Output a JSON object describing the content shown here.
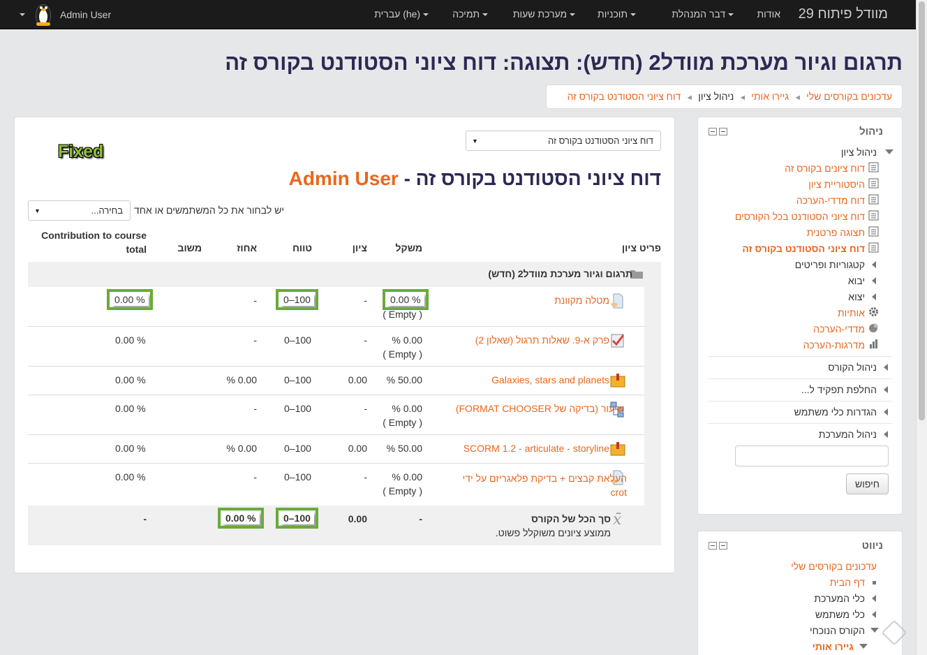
{
  "navbar": {
    "brand": "מוודל פיתוח 29",
    "items": [
      "אודות",
      "דבר המנהלת",
      "תוכניות",
      "מערכת שעות",
      "תמיכה",
      "עברית (he)"
    ],
    "user_name": "Admin User"
  },
  "page": {
    "heading": "תרגום וגיור מערכת מוודל2 (חדש): תצוגה: דוח ציוני הסטודנט בקורס זה",
    "breadcrumb": [
      "עדכונים בקורסים שלי",
      "גיירו אותי",
      "ניהול ציון",
      "דוח ציוני הסטודנט בקורס זה"
    ]
  },
  "main": {
    "report_select": "דוח ציוני הסטודנט בקורס זה",
    "fixed_logo": "Fixed",
    "report_title": "דוח ציוני הסטודנט בקורס זה - ",
    "report_user": "Admin User",
    "user_select_label": "יש לבחור את כל המשתמשים או אחד",
    "user_select_value": "בחירה...",
    "columns": {
      "item": "פריט ציון",
      "weight": "משקל",
      "grade": "ציון",
      "range": "טווח",
      "percent": "אחוז",
      "feedback": "משוב",
      "contribution_1": "Contribution to course",
      "contribution_2": "total"
    },
    "category": "תרגום וגיור מערכת מוודל2 (חדש)",
    "rows": [
      {
        "name": "מטלה מקוונת",
        "weight": "0.00 %",
        "weight_note": "( Empty )",
        "grade": "-",
        "range": "0–100",
        "percent": "-",
        "contribution": "0.00 %"
      },
      {
        "name": "פרק א-9. שאלות תרגול (שאלון 2)",
        "weight": "0.00 %",
        "weight_note": "( Empty )",
        "grade": "-",
        "range": "0–100",
        "percent": "-",
        "contribution": "0.00 %"
      },
      {
        "name": "Galaxies, stars and planets",
        "weight": "50.00 %",
        "weight_note": "",
        "grade": "0.00",
        "range": "0–100",
        "percent": "0.00 %",
        "contribution": "0.00 %"
      },
      {
        "name": "שיעור (בדיקה של FORMAT CHOOSER)",
        "weight": "0.00 %",
        "weight_note": "( Empty )",
        "grade": "-",
        "range": "0–100",
        "percent": "-",
        "contribution": "0.00 %"
      },
      {
        "name": "SCORM 1.2 - articulate - storyline",
        "weight": "50.00 %",
        "weight_note": "",
        "grade": "0.00",
        "range": "0–100",
        "percent": "0.00 %",
        "contribution": "0.00 %"
      },
      {
        "name": "העלאת קבצים + בדיקת פלאגריזם על ידי",
        "name_2": "crot",
        "weight": "0.00 %",
        "weight_note": "( Empty )",
        "grade": "-",
        "range": "0–100",
        "percent": "-",
        "contribution": "0.00 %"
      }
    ],
    "total": {
      "name": "סך הכל של הקורס",
      "note": "ממוצע ציונים משוקלל פשוט.",
      "weight": "-",
      "grade": "0.00",
      "range": "0–100",
      "percent": "0.00 %",
      "contribution": "-"
    }
  },
  "admin_block": {
    "title": "ניהול",
    "grade_admin": "ניהול ציון",
    "links": [
      "דוח ציונים בקורס זה",
      "היסטוריית ציון",
      "דוח מדדי-הערכה",
      "דוח ציוני הסטודנט בכל הקורסים",
      "תצוגה פרטנית",
      "דוח ציוני הסטודנט בקורס זה"
    ],
    "sub": [
      "קטגוריות ופריטים",
      "יבוא",
      "יצוא"
    ],
    "icon_links": [
      "אותיות",
      "מדדי-הערכה",
      "מדרגות-הערכה"
    ],
    "sections": [
      "ניהול הקורס",
      "החלפת תפקיד ל...",
      "הגדרות כלי משתמש",
      "ניהול המערכת"
    ],
    "search_button": "חיפוש"
  },
  "nav_block": {
    "title": "ניווט",
    "items": [
      "עדכונים בקורסים שלי",
      "דף הבית",
      "כלי המערכת",
      "כלי משתמש",
      "הקורס הנוכחי",
      "גיירו אותי"
    ]
  }
}
